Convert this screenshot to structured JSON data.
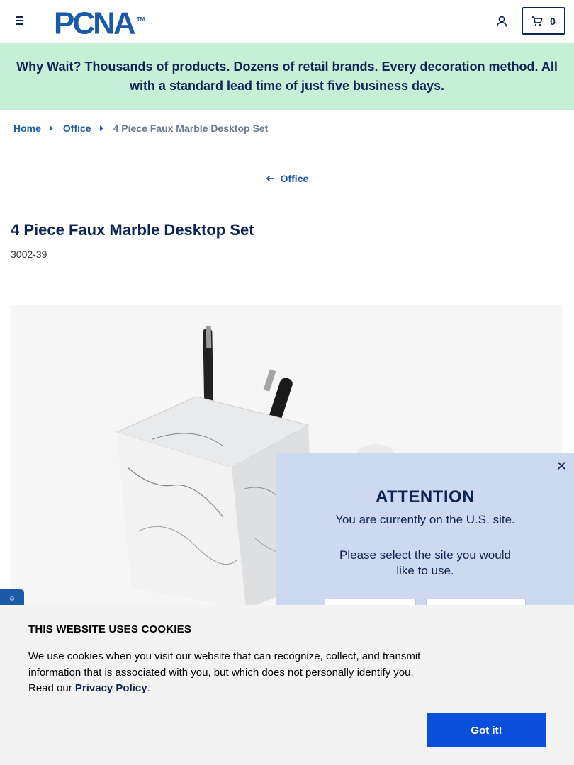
{
  "header": {
    "logo_text": "PCNA",
    "logo_mark": "TM",
    "cart_count": "0",
    "brand_color": "#1b5aa6",
    "text_color": "#0c2453"
  },
  "promo": {
    "text": "Why Wait? Thousands of products. Dozens of retail brands. Every decoration method. All with a standard lead time of just five business days.",
    "bg_color": "#c5efd6"
  },
  "breadcrumb": {
    "items": [
      "Home",
      "Office"
    ],
    "current": "4 Piece Faux Marble Desktop Set"
  },
  "back_link": {
    "label": "Office"
  },
  "product": {
    "title": "4 Piece Faux Marble Desktop Set",
    "sku": "3002-39"
  },
  "modal": {
    "heading": "ATTENTION",
    "line1": "You are currently on the U.S. site.",
    "line2": "Please select the site you would like to use.",
    "bg_color": "#ccd9f0"
  },
  "cookie": {
    "heading": "THIS WEBSITE USES COOKIES",
    "body_prefix": "We use cookies when you visit our website that can recognize, collect, and transmit information that is associated with you, but which does not personally identify you. Read our ",
    "link": "Privacy Policy",
    "body_suffix": ".",
    "button": "Got it!",
    "button_color": "#0a4fdb"
  },
  "icons": {
    "menu": "hamburger-icon",
    "account": "user-icon",
    "cart": "cart-icon",
    "close": "close-icon",
    "back": "arrow-left-icon",
    "breadcrumb_sep": "caret-right-icon"
  }
}
